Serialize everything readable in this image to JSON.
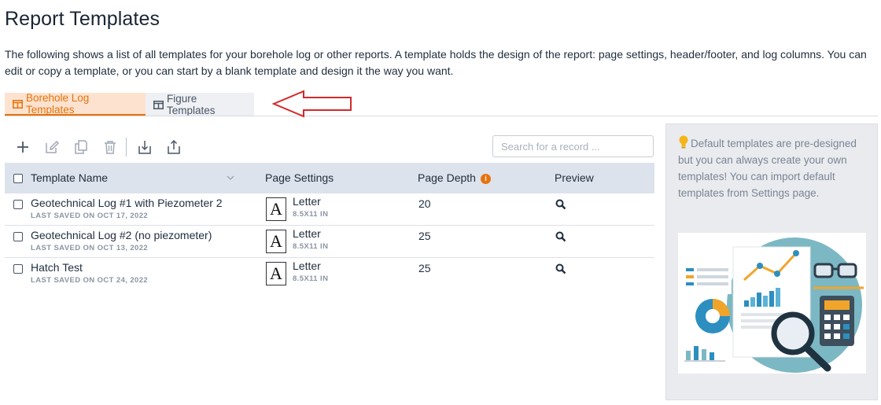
{
  "page": {
    "title": "Report Templates",
    "intro": "The following shows a list of all templates for your borehole log or other reports. A template holds the design of the report: page settings, header/footer, and log columns. You can edit or copy a template, or you can start by a blank template and design it the way you want."
  },
  "tabs": [
    {
      "label": "Borehole Log Templates",
      "active": true
    },
    {
      "label": "Figure Templates",
      "active": false
    }
  ],
  "colors": {
    "accent": "#e8720c",
    "annotation_arrow": "#d42a2a"
  },
  "toolbar": {
    "icons": [
      "add-icon",
      "edit-icon",
      "copy-icon",
      "delete-icon",
      "import-icon",
      "export-icon"
    ]
  },
  "search": {
    "placeholder": "Search for a record ...",
    "value": ""
  },
  "table": {
    "columns": {
      "name": "Template Name",
      "page_settings": "Page Settings",
      "page_depth": "Page Depth",
      "preview": "Preview"
    },
    "rows": [
      {
        "name": "Geotechnical Log #1 with Piezometer 2",
        "saved": "LAST SAVED ON OCT 17, 2022",
        "page_name": "Letter",
        "page_size": "8.5X11 IN",
        "depth": "20"
      },
      {
        "name": "Geotechnical Log #2 (no piezometer)",
        "saved": "LAST SAVED ON OCT 13, 2022",
        "page_name": "Letter",
        "page_size": "8.5X11 IN",
        "depth": "25"
      },
      {
        "name": "Hatch Test",
        "saved": "LAST SAVED ON OCT 24, 2022",
        "page_name": "Letter",
        "page_size": "8.5X11 IN",
        "depth": "25"
      }
    ]
  },
  "side_panel": {
    "text": "Default templates are pre-designed but you can always create your own templates! You can import default templates from Settings page."
  }
}
